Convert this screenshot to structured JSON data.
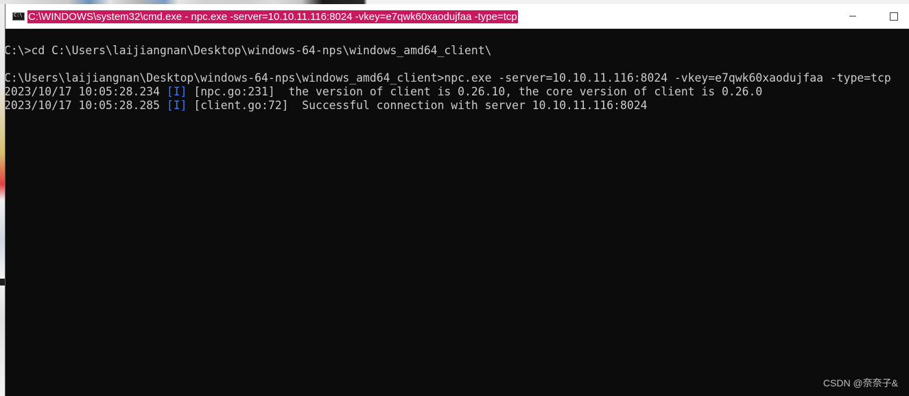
{
  "window": {
    "title": "C:\\WINDOWS\\system32\\cmd.exe - npc.exe  -server=10.10.11.116:8024 -vkey=e7qwk60xaodujfaa -type=tcp",
    "icon": "cmd-icon",
    "buttons": {
      "minimize": "minimize-icon",
      "maximize": "maximize-icon"
    }
  },
  "console": {
    "lines": [
      {
        "text": "C:\\>cd C:\\Users\\laijiangnan\\Desktop\\windows-64-nps\\windows_amd64_client\\"
      },
      {
        "text": ""
      },
      {
        "text": "C:\\Users\\laijiangnan\\Desktop\\windows-64-nps\\windows_amd64_client>npc.exe -server=10.10.11.116:8024 -vkey=e7qwk60xaodujfaa -type=tcp"
      },
      {
        "ts": "2023/10/17 10:05:28.234 ",
        "tag": "[I]",
        "msg": " [npc.go:231]  the version of client is 0.26.10, the core version of client is 0.26.0"
      },
      {
        "ts": "2023/10/17 10:05:28.285 ",
        "tag": "[I]",
        "msg": " [client.go:72]  Successful connection with server 10.10.11.116:8024"
      }
    ]
  },
  "watermark": "CSDN @奈奈子&",
  "colors": {
    "console_bg": "#0c0c0c",
    "console_fg": "#cccccc",
    "log_tag": "#3b78ff",
    "title_highlight": "#c8195e"
  }
}
